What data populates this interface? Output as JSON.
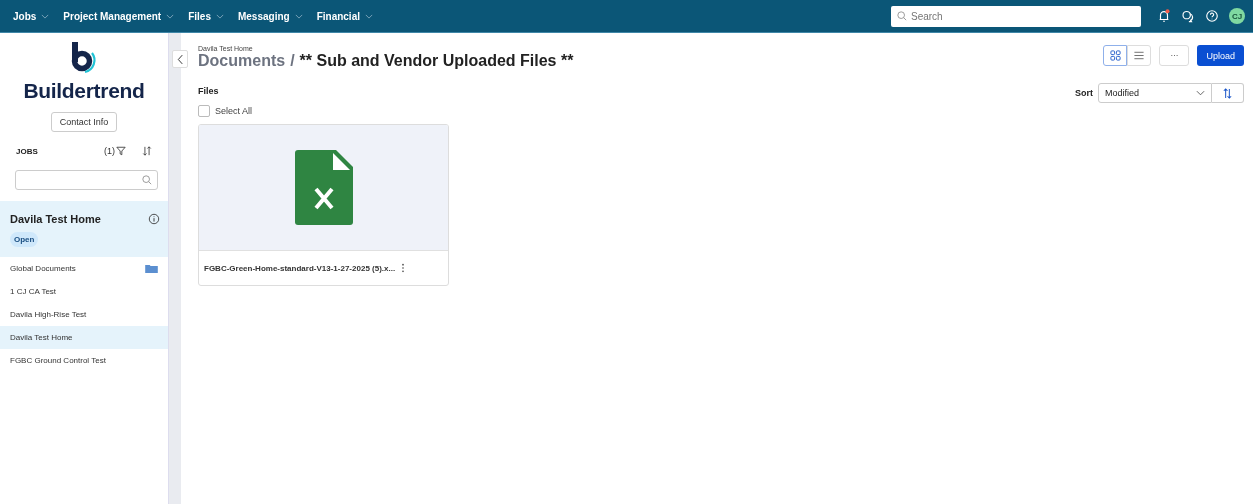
{
  "top_nav": {
    "menus": [
      {
        "label": "Jobs"
      },
      {
        "label": "Project Management"
      },
      {
        "label": "Files"
      },
      {
        "label": "Messaging"
      },
      {
        "label": "Financial"
      }
    ],
    "search": {
      "placeholder": "Search"
    },
    "notification_dot": true,
    "avatar": "CJ"
  },
  "sidebar": {
    "brand": "Buildertrend",
    "contact_button": "Contact Info",
    "jobs_label": "JOBS",
    "filter_count": "(1)",
    "current_job": {
      "name": "Davila Test Home",
      "status": "Open"
    },
    "items": [
      {
        "label": "Global Documents",
        "kind": "folder",
        "selected": false
      },
      {
        "label": "1 CJ CA Test",
        "kind": "job",
        "selected": false
      },
      {
        "label": "Davila High-Rise Test",
        "kind": "job",
        "selected": false
      },
      {
        "label": "Davila Test Home",
        "kind": "job",
        "selected": true
      },
      {
        "label": "FGBC Ground Control Test",
        "kind": "job",
        "selected": false
      }
    ]
  },
  "header": {
    "breadcrumb": "Davila Test Home",
    "parent": "Documents",
    "separator": "/",
    "title": "** Sub and Vendor Uploaded Files **"
  },
  "view_toggle": [
    {
      "kind": "grid",
      "selected": true
    },
    {
      "kind": "list",
      "selected": false
    }
  ],
  "more_button": "···",
  "upload_button": "Upload",
  "sort": {
    "label": "Sort",
    "value": "Modified"
  },
  "files_label": "Files",
  "select_all": {
    "label": "Select All",
    "checked": false
  },
  "files": [
    {
      "name": "FGBC-Green-Home-standard-V13-1-27-2025 (5).x...",
      "kind": "excel"
    }
  ]
}
